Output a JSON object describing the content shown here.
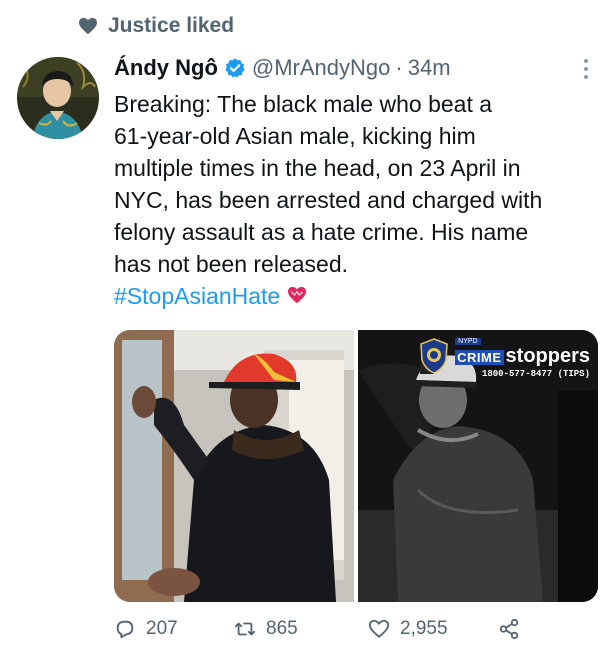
{
  "social_context": {
    "label": "Justice liked",
    "icon": "heart-icon"
  },
  "tweet": {
    "author": {
      "name": "Ándy Ngô",
      "handle": "@MrAndyNgo",
      "verified": true,
      "time": "34m"
    },
    "text_lines": [
      "Breaking: The black male who beat a",
      "61-year-old Asian male, kicking him",
      "multiple times in the head, on 23 April in",
      "NYC, has been arrested and charged with",
      "felony assault as a hate crime. His name",
      "has not been released."
    ],
    "hashtag": "#StopAsianHate",
    "media": {
      "count": 2,
      "overlay": {
        "agency": "NYPD",
        "brand_crime": "CRIME",
        "brand_stoppers": "stoppers",
        "tips_line": "1800-577-8477 (TIPS)"
      }
    },
    "stats": {
      "replies": "207",
      "retweets": "865",
      "likes": "2,955"
    }
  },
  "colors": {
    "accent": "#1d9bf0",
    "muted": "#536471",
    "text": "#0f1419"
  }
}
